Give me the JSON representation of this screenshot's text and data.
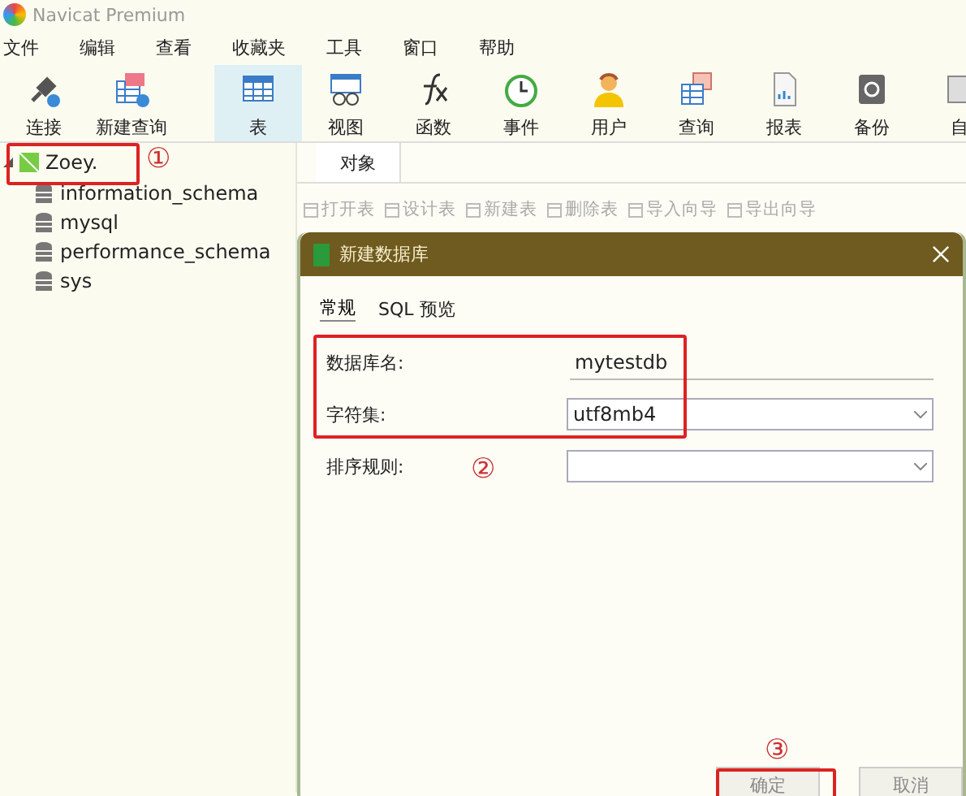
{
  "window": {
    "title": "Navicat Premium"
  },
  "menu": [
    "文件",
    "编辑",
    "查看",
    "收藏夹",
    "工具",
    "窗口",
    "帮助"
  ],
  "toolbar": [
    {
      "label": "连接",
      "selected": false
    },
    {
      "label": "新建查询",
      "selected": false
    },
    {
      "label": "表",
      "selected": true
    },
    {
      "label": "视图",
      "selected": false
    },
    {
      "label": "函数",
      "selected": false
    },
    {
      "label": "事件",
      "selected": false
    },
    {
      "label": "用户",
      "selected": false
    },
    {
      "label": "查询",
      "selected": false
    },
    {
      "label": "报表",
      "selected": false
    },
    {
      "label": "备份",
      "selected": false
    },
    {
      "label": "自",
      "selected": false
    }
  ],
  "sidebar": {
    "connection": {
      "label": "Zoey.",
      "expanded": true,
      "children": [
        {
          "label": "information_schema"
        },
        {
          "label": "mysql"
        },
        {
          "label": "performance_schema"
        },
        {
          "label": "sys"
        }
      ]
    }
  },
  "object_tabs": [
    {
      "label": "对象",
      "selected": true
    }
  ],
  "object_toolbar": [
    {
      "label": "打开表",
      "disabled": true
    },
    {
      "label": "设计表",
      "disabled": true
    },
    {
      "label": "新建表",
      "disabled": true
    },
    {
      "label": "删除表",
      "disabled": true
    },
    {
      "label": "导入向导",
      "disabled": true
    },
    {
      "label": "导出向导",
      "disabled": true
    }
  ],
  "dialog": {
    "title": "新建数据库",
    "tabs": [
      {
        "label": "常规",
        "selected": true
      },
      {
        "label": "SQL 预览",
        "selected": false
      }
    ],
    "fields": [
      {
        "kind": "text",
        "label": "数据库名:",
        "value": "mytestdb"
      },
      {
        "kind": "select",
        "label": "字符集:",
        "value": "utf8mb4"
      },
      {
        "kind": "select",
        "label": "排序规则:"
      }
    ],
    "buttons": [
      "确定",
      "取消"
    ]
  },
  "annotations": [
    {
      "marker": "①"
    },
    {
      "marker": "②"
    },
    {
      "marker": "③"
    }
  ]
}
